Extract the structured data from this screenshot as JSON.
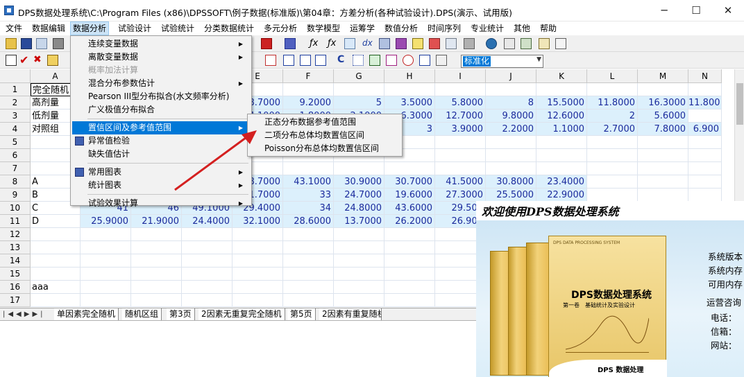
{
  "window": {
    "title": "DPS数据处理系统\\C:\\Program Files (x86)\\DPSSOFT\\例子数据(标准版)\\第04章：方差分析(各种试验设计).DPS(演示、试用版)",
    "min": "─",
    "max": "☐",
    "close": "✕"
  },
  "menubar": [
    "文件",
    "数据编辑",
    "数据分析",
    "试验设计",
    "试验统计",
    "分类数据统计",
    "多元分析",
    "数学模型",
    "运筹学",
    "数值分析",
    "时间序列",
    "专业统计",
    "其他",
    "帮助"
  ],
  "menubar_active": "数据分析",
  "toolbar": {
    "combo_value": "标准化"
  },
  "dropdown": {
    "items": [
      {
        "label": "连续变量数据",
        "sub": true
      },
      {
        "label": "离散变量数据",
        "sub": true
      },
      {
        "label": "概率加法计算",
        "disabled": true
      },
      {
        "label": "混合分布参数估计",
        "sub": true
      },
      {
        "label": "Pearson III型分布拟合(水文频率分析)"
      },
      {
        "label": "广义极值分布拟合"
      },
      {
        "label": "置信区间及参考值范围",
        "sub": true,
        "highlight": true
      },
      {
        "label": "异常值检验",
        "icon": true
      },
      {
        "label": "缺失值估计"
      },
      {
        "label": "常用图表",
        "sub": true,
        "icon": true
      },
      {
        "label": "统计图表",
        "sub": true
      },
      {
        "label": "试验效果计算",
        "sub": true
      }
    ]
  },
  "submenu": [
    "正态分布数据参考值范围",
    "二项分布总体均数置信区间",
    "Poisson分布总体均数置信区间"
  ],
  "grid": {
    "columns": [
      "A",
      "B",
      "C",
      "D",
      "E",
      "F",
      "G",
      "H",
      "I",
      "J",
      "K",
      "L",
      "M",
      "N"
    ],
    "rows": [
      {
        "n": "1",
        "cells": [
          "完全随机",
          "",
          "",
          "",
          "",
          "",
          "",
          "",
          "",
          "",
          "",
          "",
          "",
          ""
        ]
      },
      {
        "n": "2",
        "cells": [
          "高剂量",
          "",
          "",
          "",
          "8.7000",
          "9.2000",
          "5",
          "3.5000",
          "5.8000",
          "8",
          "15.5000",
          "11.8000",
          "16.3000",
          "11.800"
        ]
      },
      {
        "n": "3",
        "cells": [
          "低剂量",
          "",
          "",
          "",
          "4.1000",
          "1.8000",
          "2.1000",
          "6.3000",
          "12.7000",
          "9.8000",
          "12.6000",
          "2",
          "5.6000",
          ""
        ]
      },
      {
        "n": "4",
        "cells": [
          "对照组",
          "",
          "",
          "",
          "",
          "",
          "",
          "3",
          "3.9000",
          "2.2000",
          "1.1000",
          "2.7000",
          "7.8000",
          "6.900"
        ]
      },
      {
        "n": "5",
        "cells": [
          "",
          "",
          "",
          "",
          "",
          "",
          "",
          "",
          "",
          "",
          "",
          "",
          "",
          ""
        ]
      },
      {
        "n": "6",
        "cells": [
          "",
          "",
          "",
          "",
          "",
          "",
          "",
          "",
          "",
          "",
          "",
          "",
          "",
          ""
        ]
      },
      {
        "n": "7",
        "cells": [
          "",
          "",
          "",
          "",
          "",
          "",
          "",
          "",
          "",
          "",
          "",
          "",
          "",
          ""
        ]
      },
      {
        "n": "8",
        "cells": [
          "A",
          "",
          "",
          "",
          "8.7000",
          "43.1000",
          "30.9000",
          "30.7000",
          "41.5000",
          "30.8000",
          "23.4000",
          "",
          "",
          ""
        ]
      },
      {
        "n": "9",
        "cells": [
          "B",
          "",
          "",
          "",
          "1.7000",
          "33",
          "24.7000",
          "19.6000",
          "27.3000",
          "25.5000",
          "22.9000",
          "",
          "",
          ""
        ]
      },
      {
        "n": "10",
        "cells": [
          "C",
          "41",
          "46",
          "49.1000",
          "29.4000",
          "34",
          "24.8000",
          "43.6000",
          "29.500",
          "",
          "",
          "",
          "",
          ""
        ]
      },
      {
        "n": "11",
        "cells": [
          "D",
          "25.9000",
          "21.9000",
          "24.4000",
          "32.1000",
          "28.6000",
          "13.7000",
          "26.2000",
          "26.900",
          "",
          "",
          "",
          "",
          ""
        ]
      },
      {
        "n": "12",
        "cells": [
          "",
          "",
          "",
          "",
          "",
          "",
          "",
          "",
          "",
          "",
          "",
          "",
          "",
          ""
        ]
      },
      {
        "n": "13",
        "cells": [
          "",
          "",
          "",
          "",
          "",
          "",
          "",
          "",
          "",
          "",
          "",
          "",
          "",
          ""
        ]
      },
      {
        "n": "14",
        "cells": [
          "",
          "",
          "",
          "",
          "",
          "",
          "",
          "",
          "",
          "",
          "",
          "",
          "",
          ""
        ]
      },
      {
        "n": "15",
        "cells": [
          "",
          "",
          "",
          "",
          "",
          "",
          "",
          "",
          "",
          "",
          "",
          "",
          "",
          ""
        ]
      },
      {
        "n": "16",
        "cells": [
          "aaa",
          "",
          "",
          "",
          "",
          "",
          "",
          "",
          "",
          "",
          "",
          "",
          "",
          ""
        ]
      },
      {
        "n": "17",
        "cells": [
          "",
          "",
          "",
          "",
          "",
          "",
          "",
          "",
          "",
          "",
          "",
          "",
          "",
          ""
        ]
      }
    ]
  },
  "sheet_tabs": [
    "单因素完全随机",
    "随机区组",
    "第3页",
    "2因素无重复完全随机",
    "第5页",
    "2因素有重复随机"
  ],
  "splash": {
    "title": "欢迎使用DPS数据处理系统",
    "book_title": "DPS数据处理系统",
    "book_sub": "第一卷　基础统计及实验设计",
    "book_en": "DPS DATA PROCESSING SYSTEM",
    "book_bottom": "DPS 数据处理",
    "info": [
      "系统版本",
      "系统内存",
      "可用内存",
      "运营咨询",
      "电话：",
      "信箱：",
      "网站："
    ]
  },
  "colors": {
    "num_bg": "#dcf0fc",
    "num_fg": "#1a2a9c",
    "highlight": "#0078d7",
    "arrow": "#d42020"
  }
}
